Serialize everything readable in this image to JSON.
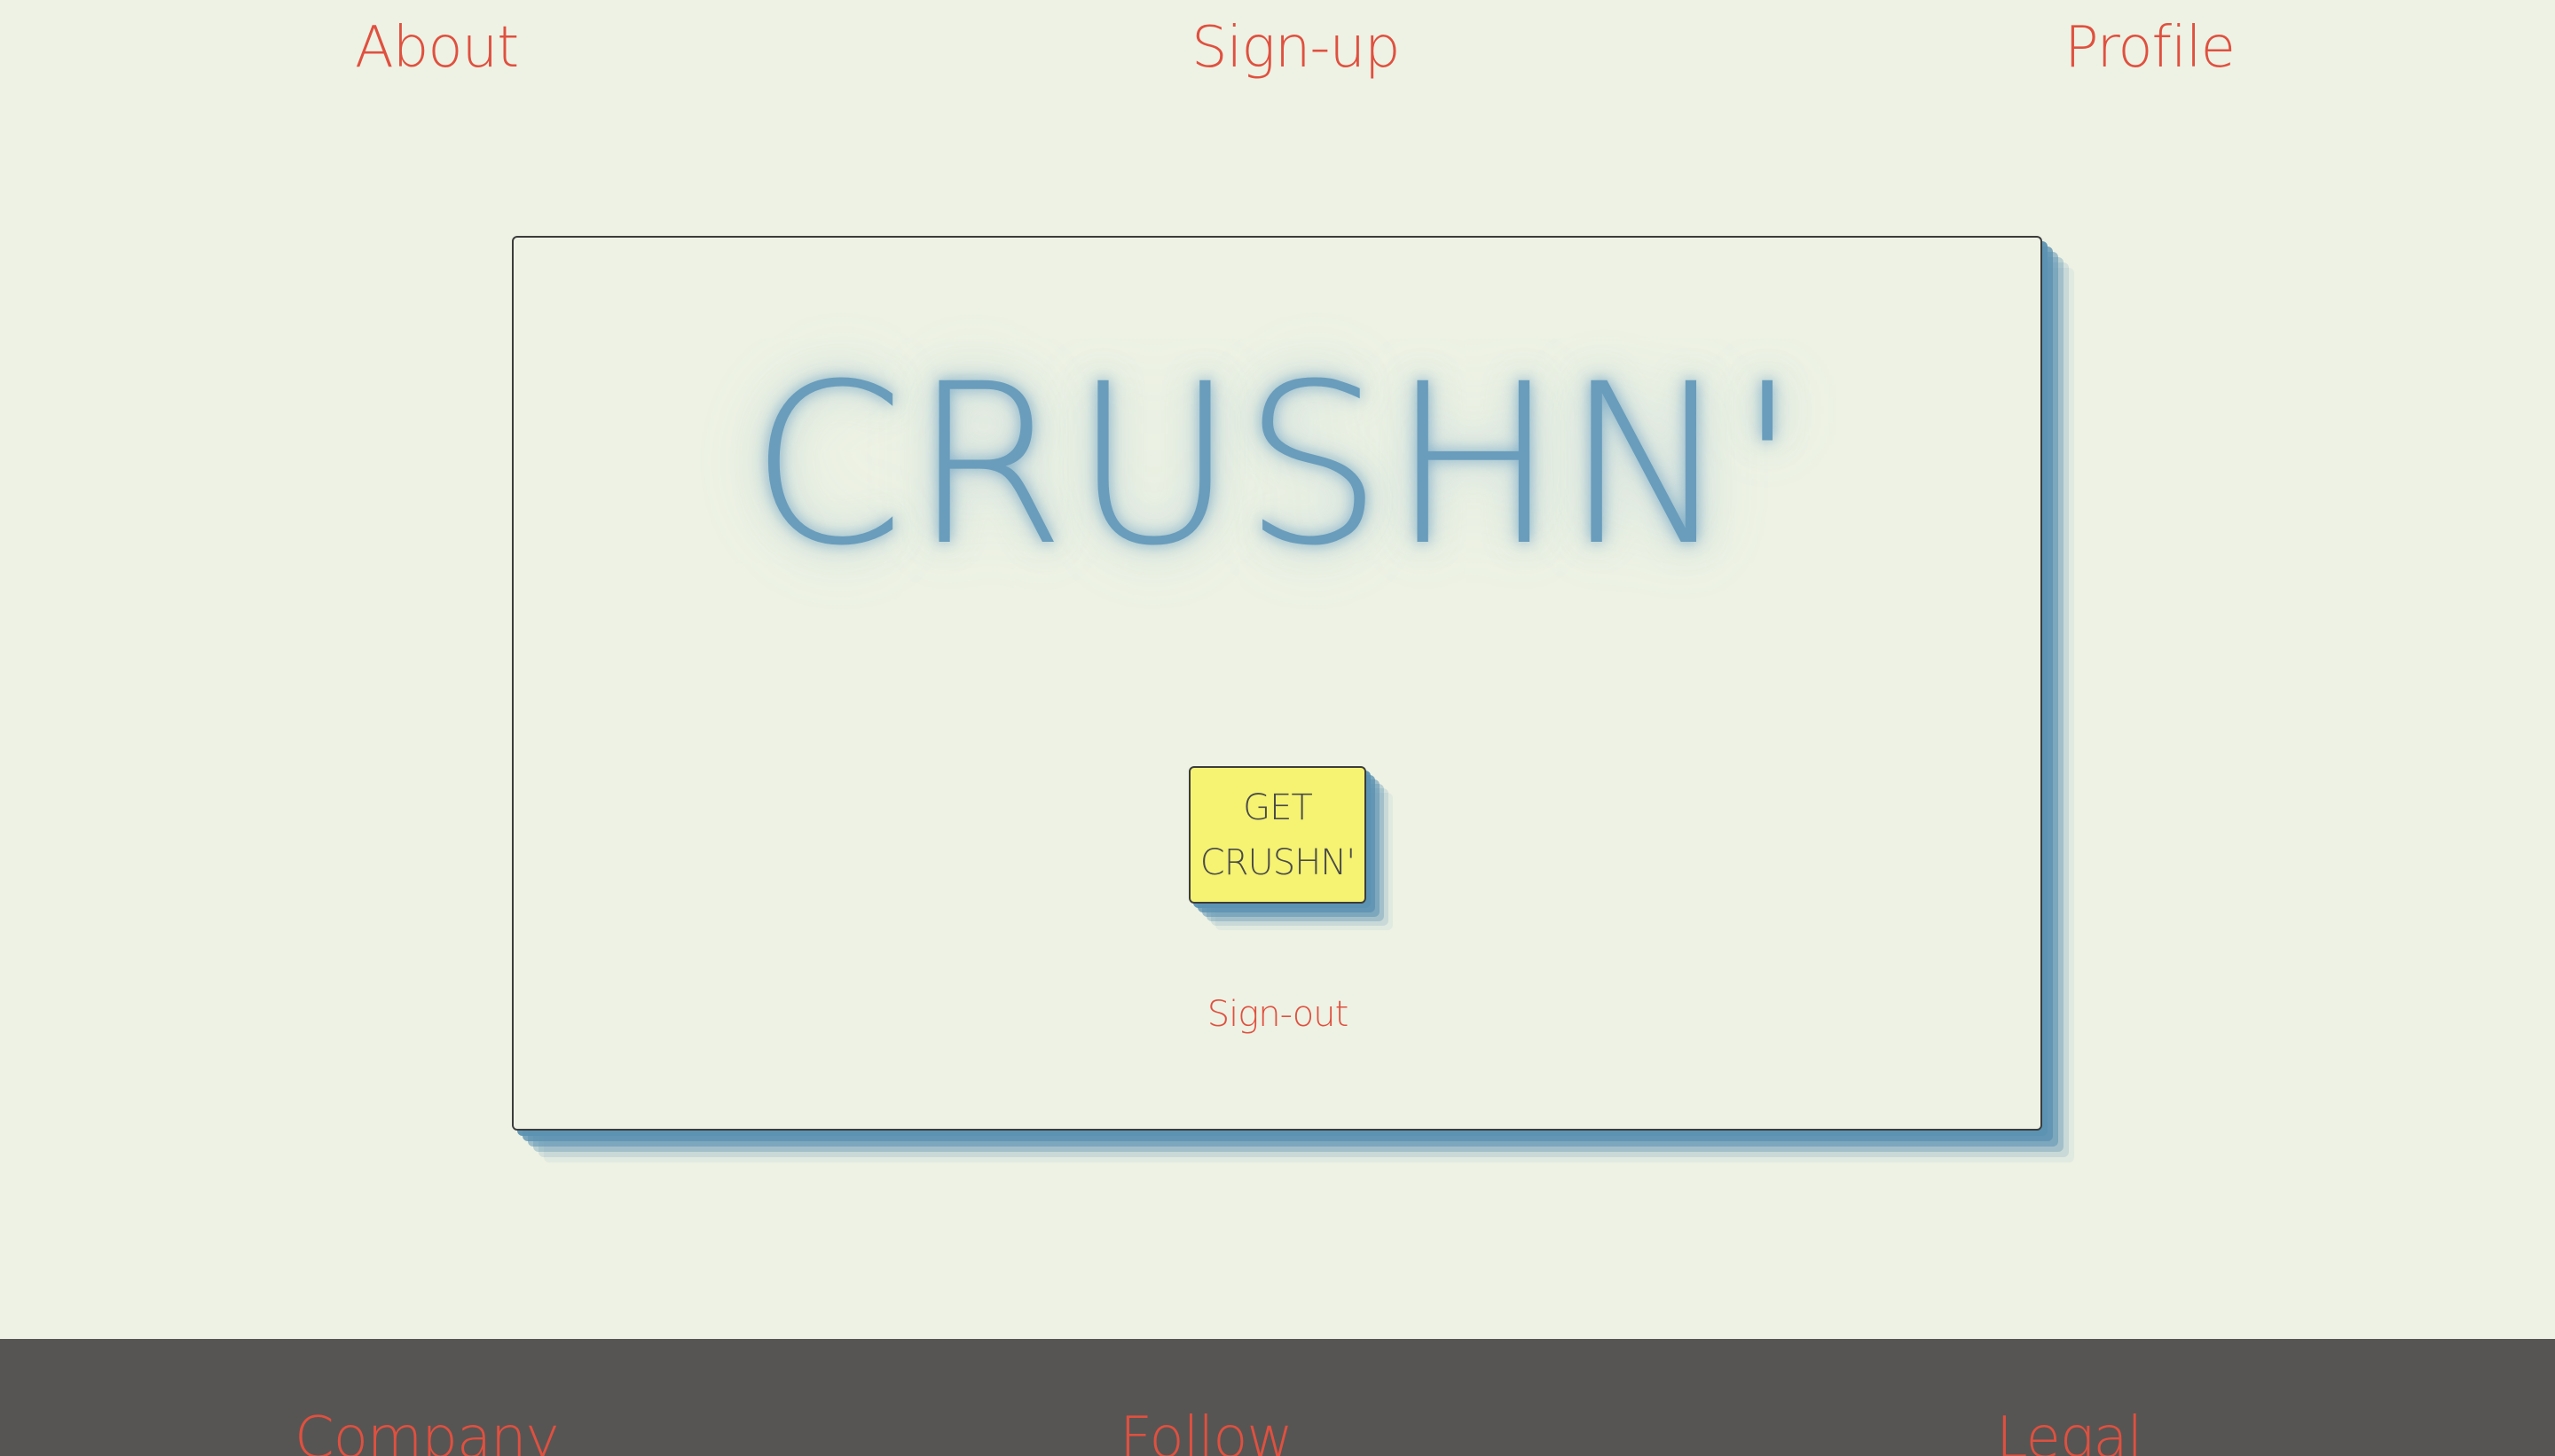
{
  "nav": {
    "about": "About",
    "signup": "Sign-up",
    "profile": "Profile"
  },
  "hero": {
    "title": "CRUSHN'",
    "cta_line1": "GET",
    "cta_line2": "CRUSHN'",
    "signout": "Sign-out"
  },
  "footer": {
    "company": "Company",
    "follow": "Follow",
    "legal": "Legal"
  },
  "colors": {
    "background": "#edf2e4",
    "accent_text": "#e0503f",
    "brand_blue": "#6a9dbc",
    "cta_yellow": "#f5f371",
    "footer_bg": "#565554"
  }
}
